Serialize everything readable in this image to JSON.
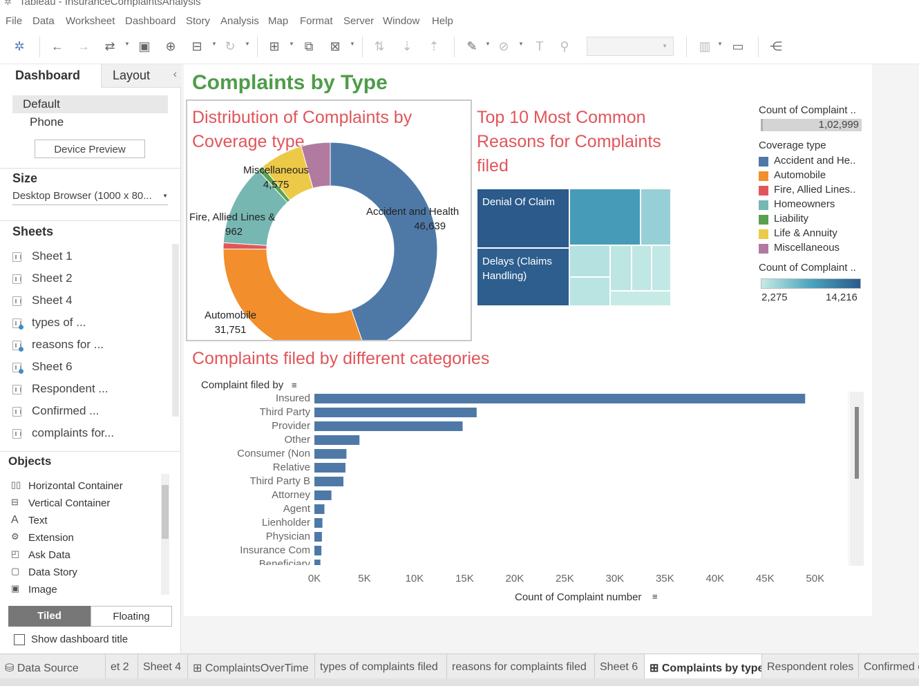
{
  "app": {
    "title": "Tableau - InsuranceComplaintsAnalysis"
  },
  "menu": [
    "File",
    "Data",
    "Worksheet",
    "Dashboard",
    "Story",
    "Analysis",
    "Map",
    "Format",
    "Server",
    "Window",
    "Help"
  ],
  "left": {
    "tab_dashboard": "Dashboard",
    "tab_layout": "Layout",
    "layouts": [
      "Default",
      "Phone"
    ],
    "device_preview": "Device Preview",
    "size_heading": "Size",
    "size_value": "Desktop Browser (1000 x 80...",
    "sheets_heading": "Sheets",
    "sheets": [
      {
        "label": "Sheet 1",
        "used": false
      },
      {
        "label": "Sheet 2",
        "used": false
      },
      {
        "label": "Sheet 4",
        "used": false
      },
      {
        "label": "types of ...",
        "used": true
      },
      {
        "label": "reasons for ...",
        "used": true
      },
      {
        "label": "Sheet 6",
        "used": true
      },
      {
        "label": "Respondent ...",
        "used": false
      },
      {
        "label": "Confirmed ...",
        "used": false
      },
      {
        "label": "complaints for...",
        "used": false
      }
    ],
    "objects_heading": "Objects",
    "objects": [
      {
        "label": "Horizontal Container",
        "icon": "horizontal-container-icon"
      },
      {
        "label": "Vertical Container",
        "icon": "vertical-container-icon"
      },
      {
        "label": "Text",
        "icon": "text-icon"
      },
      {
        "label": "Extension",
        "icon": "extension-icon"
      },
      {
        "label": "Ask Data",
        "icon": "ask-data-icon"
      },
      {
        "label": "Data Story",
        "icon": "data-story-icon"
      },
      {
        "label": "Image",
        "icon": "image-icon"
      }
    ],
    "tiled": "Tiled",
    "floating": "Floating",
    "show_title": "Show dashboard title"
  },
  "dashboard": {
    "title": "Complaints by Type",
    "donut_title_1": "Distribution of Complaints by",
    "donut_title_2": "Coverage type",
    "treemap_title_1": "Top 10 Most Common",
    "treemap_title_2": "Reasons for Complaints",
    "treemap_title_3": "filed",
    "bar_title": "Complaints filed by different categories",
    "donut_labels": {
      "accident_name": "Accident and Health",
      "accident_value": "46,639",
      "auto_name": "Automobile",
      "auto_value": "31,751",
      "fire_name": "Fire, Allied Lines &",
      "fire_value": "962",
      "misc_name": "Miscellaneous",
      "misc_value": "4,575"
    },
    "treemap_labels": {
      "denial": "Denial Of Claim",
      "delays": "Delays (Claims Handling)"
    },
    "legend": {
      "count_title": "Count of Complaint ..",
      "count_value": "1,02,999",
      "coverage_title": "Coverage type",
      "coverage_items": [
        {
          "label": "Accident and He..",
          "color": "#4e79a7"
        },
        {
          "label": "Automobile",
          "color": "#f28e2b"
        },
        {
          "label": "Fire, Allied Lines..",
          "color": "#e15759"
        },
        {
          "label": "Homeowners",
          "color": "#76b7b2"
        },
        {
          "label": "Liability",
          "color": "#59a14f"
        },
        {
          "label": "Life & Annuity",
          "color": "#edc948"
        },
        {
          "label": "Miscellaneous",
          "color": "#b07aa1"
        }
      ],
      "gradient_title": "Count of Complaint ..",
      "gradient_min": "2,275",
      "gradient_max": "14,216"
    }
  },
  "tabs": [
    {
      "label": "Data Source",
      "icon": "database-icon",
      "active": false
    },
    {
      "label": "et 2",
      "active": false
    },
    {
      "label": "Sheet 4",
      "active": false
    },
    {
      "label": "ComplaintsOverTime",
      "icon": "dashboard-icon",
      "active": false
    },
    {
      "label": "types of complaints filed",
      "active": false
    },
    {
      "label": "reasons for complaints filed",
      "active": false
    },
    {
      "label": "Sheet 6",
      "active": false
    },
    {
      "label": "Complaints by type",
      "icon": "dashboard-icon",
      "active": true
    },
    {
      "label": "Respondent roles",
      "active": false
    },
    {
      "label": "Confirmed c",
      "active": false
    }
  ],
  "chart_data": [
    {
      "type": "pie",
      "title": "Distribution of Complaints by Coverage type",
      "categories": [
        "Accident and Health",
        "Automobile",
        "Fire, Allied Lines &",
        "Homeowners",
        "Liability",
        "Life & Annuity",
        "Miscellaneous"
      ],
      "values": [
        46639,
        31751,
        962,
        12800,
        900,
        6800,
        4575
      ],
      "colors": [
        "#4e79a7",
        "#f28e2b",
        "#e15759",
        "#76b7b2",
        "#59a14f",
        "#edc948",
        "#b07aa1"
      ]
    },
    {
      "type": "heatmap",
      "title": "Top 10 Most Common Reasons for Complaints filed",
      "categories": [
        "Denial Of Claim",
        "Delays (Claims Handling)",
        "",
        "",
        "",
        "",
        "",
        "",
        "",
        ""
      ],
      "values": [
        14216,
        13900,
        9000,
        4600,
        3100,
        2900,
        2700,
        2600,
        2500,
        2275
      ]
    },
    {
      "type": "bar",
      "title": "Complaints filed by different categories",
      "ylabel": "Complaint filed by",
      "xlabel": "Count of Complaint number",
      "categories": [
        "Insured",
        "Third Party",
        "Provider",
        "Other",
        "Consumer (Non",
        "Relative",
        "Third Party B",
        "Attorney",
        "Agent",
        "Lienholder",
        "Physician",
        "Insurance Com",
        "Beneficiary"
      ],
      "values": [
        49000,
        16200,
        14800,
        4500,
        3200,
        3100,
        2900,
        1700,
        1000,
        800,
        750,
        700,
        600
      ],
      "xlim": [
        0,
        52500
      ],
      "ticks": [
        "0K",
        "5K",
        "10K",
        "15K",
        "20K",
        "25K",
        "30K",
        "35K",
        "40K",
        "45K",
        "50K"
      ],
      "color": "#4e79a7"
    }
  ]
}
